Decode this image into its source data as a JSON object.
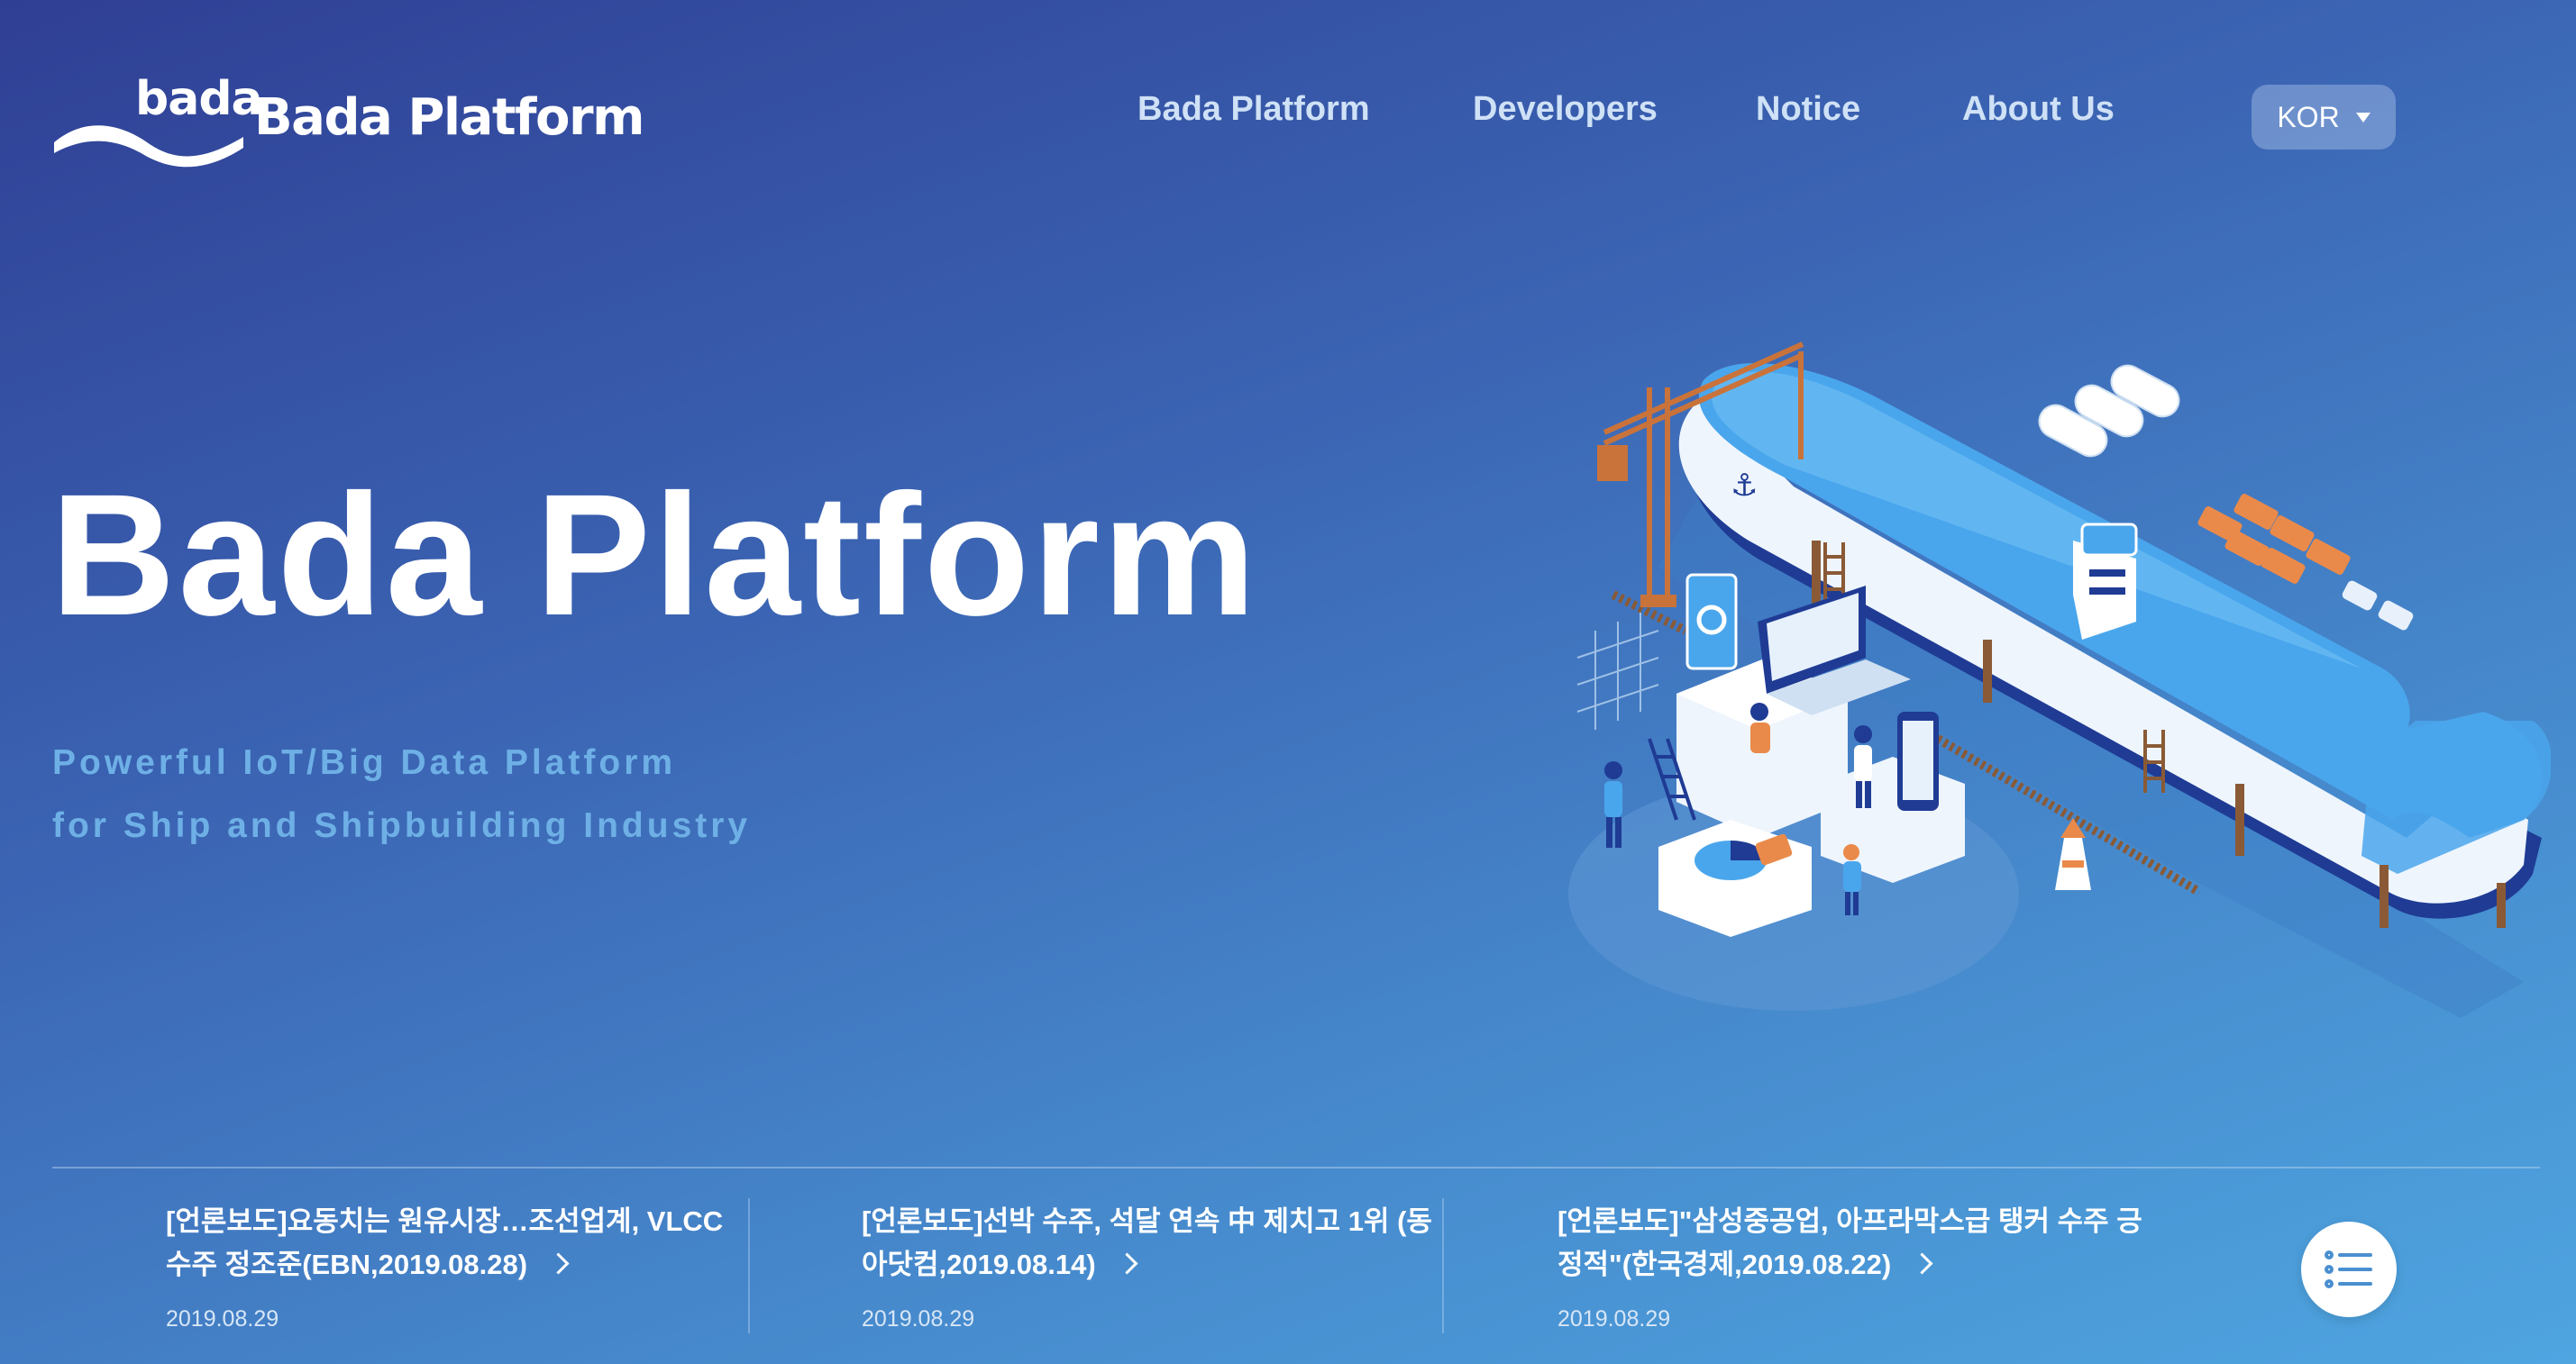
{
  "brand": {
    "logo_mark_text": "bada",
    "logo_text": "Bada Platform"
  },
  "nav": {
    "items": [
      {
        "label": "Bada Platform"
      },
      {
        "label": "Developers"
      },
      {
        "label": "Notice"
      },
      {
        "label": "About Us"
      }
    ],
    "language": "KOR"
  },
  "hero": {
    "title": "Bada Platform",
    "subtitle_line1": "Powerful IoT/Big Data Platform",
    "subtitle_line2": "for Ship and Shipbuilding Industry"
  },
  "news": [
    {
      "title": "[언론보도]요동치는 원유시장…조선업계, VLCC 수주 정조준(EBN,2019.08.28)",
      "date": "2019.08.29"
    },
    {
      "title": "[언론보도]선박 수주, 석달 연속 中 제치고 1위 (동아닷컴,2019.08.14)",
      "date": "2019.08.29"
    },
    {
      "title": "[언론보도]\"삼성중공업, 아프라막스급 탱커 수주 긍정적\"(한국경제,2019.08.22)",
      "date": "2019.08.29"
    }
  ],
  "icons": {
    "list_button": "list-icon",
    "news_arrow": "chevron-right-icon",
    "language_caret": "caret-down-icon",
    "logo_wave": "wave-icon"
  },
  "colors": {
    "bg_start": "#2f3f94",
    "bg_end": "#4ea5e0",
    "subtitle": "#6eb0e6",
    "nav_text": "#cfe1f6",
    "ship_blue": "#4aa6ec",
    "ship_navy": "#1f3b94",
    "accent_orange": "#ea8a4a"
  }
}
